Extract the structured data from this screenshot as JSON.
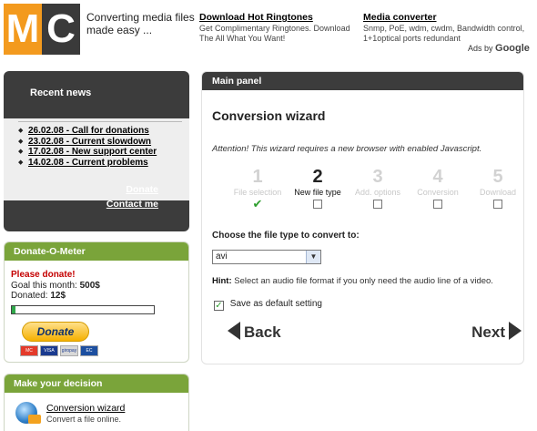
{
  "header": {
    "logo": [
      "M",
      "C"
    ],
    "tagline": "Converting media files made easy ...",
    "ads": [
      {
        "title": "Download Hot Ringtones",
        "text": "Get Complimentary Ringtones. Download The All What You Want!"
      },
      {
        "title": "Media converter",
        "text": "Snmp, PoE, wdm, cwdm, Bandwidth control, 1+1optical ports redundant"
      }
    ],
    "ads_by": "Ads by",
    "ads_brand": "Google"
  },
  "recent_news": {
    "title": "Recent news",
    "items": [
      "26.02.08 - Call for donations",
      "23.02.08 - Current slowdown",
      "17.02.08 - New support center",
      "14.02.08 - Current problems"
    ],
    "links": [
      "Donate",
      "Contact me"
    ]
  },
  "donate": {
    "title": "Donate-O-Meter",
    "please": "Please donate!",
    "goal_label": "Goal this month:",
    "goal_value": "500$",
    "donated_label": "Donated:",
    "donated_value": "12$",
    "progress_fraction": 0.024,
    "button": "Donate",
    "cards": [
      "MC",
      "VISA",
      "giropay",
      "EC"
    ]
  },
  "decision": {
    "title": "Make your decision",
    "item_title": "Conversion wizard",
    "item_desc": "Convert a file online."
  },
  "main": {
    "panel_title": "Main panel",
    "wizard_title": "Conversion wizard",
    "attention": "Attention! This wizard requires a new browser with enabled Javascript.",
    "steps": [
      {
        "num": "1",
        "label": "File selection",
        "state": "done"
      },
      {
        "num": "2",
        "label": "New file type",
        "state": "active"
      },
      {
        "num": "3",
        "label": "Add. options",
        "state": "pending"
      },
      {
        "num": "4",
        "label": "Conversion",
        "state": "pending"
      },
      {
        "num": "5",
        "label": "Download",
        "state": "pending"
      }
    ],
    "choose_label": "Choose the file type to convert to:",
    "selected_type": "avi",
    "hint_label": "Hint:",
    "hint_text": "Select an audio file format if you only need the audio line of a video.",
    "default_label": "Save as default setting",
    "back_label": "Back",
    "next_label": "Next"
  },
  "colors": {
    "logo_orange": "#f39a1e",
    "dark_panel": "#3c3c3c",
    "green_header": "#7aa43a",
    "donate_red": "#c40000"
  }
}
